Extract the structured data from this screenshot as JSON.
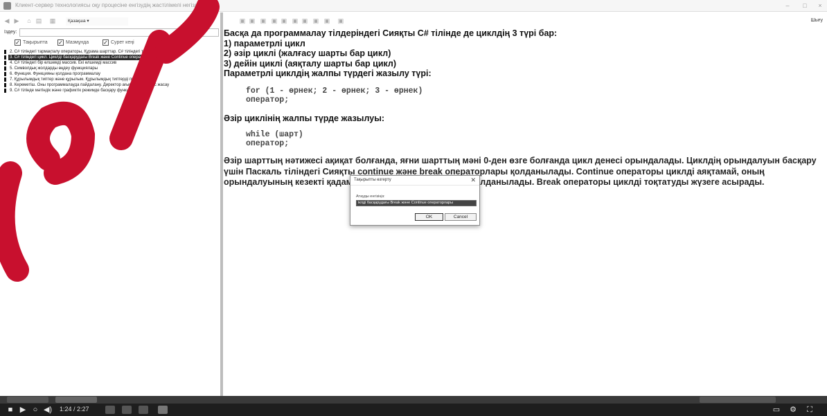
{
  "window": {
    "title": "Клиент-сервер технологиясы оқу процесіне енгізудің жастілімелі негіздері",
    "controls": [
      "–",
      "□",
      "×"
    ]
  },
  "left_toolbar": {
    "icons": [
      "back-icon",
      "forward-icon",
      "home-icon",
      "print-icon",
      "font-icon"
    ],
    "language_label": "Қазақша ▾"
  },
  "search": {
    "label": "Іздеу:",
    "value": ""
  },
  "filters": [
    {
      "label": "Тақырыпта",
      "checked": true
    },
    {
      "label": "Мазмұнда",
      "checked": true
    },
    {
      "label": "Сурет кеңі",
      "checked": true
    }
  ],
  "tree": [
    {
      "label": "2. C# тіліндегі тармақталу операторы, Құрама шарттар. C# тіліндегі таңдау командасы",
      "selected": false
    },
    {
      "label": "3. C# тіліндегі цикл. Циклді басқарудағы Break және Continue операторлары",
      "selected": true
    },
    {
      "label": "4. C# тіліндегі бір өлшемді массив. Екі өлшемді массив",
      "selected": false
    },
    {
      "label": "5. Символдық жолдарды өңдеу функциялары",
      "selected": false
    },
    {
      "label": "6. Функция. Функцияны қолдана программалау",
      "selected": false
    },
    {
      "label": "7. Құрылымдық типтер және құрылым. Құрылымдық типтерді программалау",
      "selected": false
    },
    {
      "label": "8. Кереметіш. Оны программалауда пайдалану. Директор ағымының жұмыс жасау",
      "selected": false
    },
    {
      "label": "9. C# тілінде мәтіндік және графиктік режимде басқару функциялары",
      "selected": false
    }
  ],
  "right_toolbar": {
    "print_label": "Шығу"
  },
  "content": {
    "intro": "Басқа да программалау тілдеріндегі Сияқты C# тілінде де циклдің 3 түрі бар:",
    "items": [
      "1) параметрлі цикл",
      "2) әзір циклі (жалғасу шарты бар цикл)",
      "3) дейін циклі (аяқталу шарты бар цикл)"
    ],
    "param_heading": "Параметрлі циклдің жалпы түрдегі жазылу түрі:",
    "code_for": [
      "for (1 - өрнек; 2 - өрнек; 3 - өрнек)",
      "оператор;"
    ],
    "while_heading": "Әзір циклінің жалпы түрде жазылуы:",
    "code_while": [
      "while (шарт)",
      "оператор;"
    ],
    "paragraph": "Әзір шарттың нәтижесі ақиқат болғанда, яғни шарттың мәні 0-ден өзге болғанда цикл денесі орындалады. Циклдің орындалуын басқару үшін Паскаль тіліндегі Сияқты continue және break операторлары қолданылады. Continue операторы циклді аяқтамай, оның орындалуының кезекті қадамын тоқтату қажет болғанда қолданылады. Break операторы циклді тоқтатуды жүзеге асырады."
  },
  "dialog": {
    "title": "Тақырыпты өзгерту",
    "field_label": "Атауды енгізіңіз:",
    "field_value": "іклді басқарудағы Break және Continue операторлары",
    "ok_label": "OK",
    "cancel_label": "Cancel",
    "close": "✕"
  },
  "player": {
    "time": "1:24 / 2:27"
  }
}
